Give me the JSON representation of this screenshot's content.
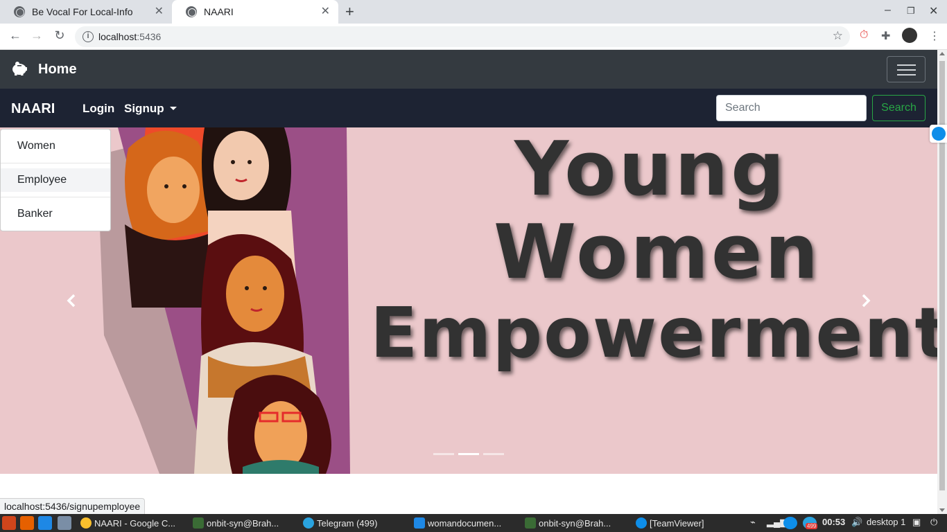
{
  "browser": {
    "tabs": [
      {
        "title": "Be Vocal For Local-Info",
        "active": false
      },
      {
        "title": "NAARI",
        "active": true
      }
    ],
    "url_host": "localhost",
    "url_port": ":5436",
    "status_url": "localhost:5436/signupemployee"
  },
  "topnav": {
    "home_label": "Home"
  },
  "subnav": {
    "brand": "NAARI",
    "login_label": "Login",
    "signup_label": "Signup",
    "search_placeholder": "Search",
    "search_button": "Search"
  },
  "signup_dropdown": {
    "items": [
      "Women",
      "Employee",
      "Banker"
    ],
    "hovered_item": "Employee"
  },
  "carousel": {
    "lines": [
      "Young",
      "Women",
      "Empowerment"
    ],
    "slide_count": 3,
    "active_slide": 2,
    "background_color": "#ebc8cb"
  },
  "taskbar": {
    "items": [
      "NAARI - Google C...",
      "onbit-syn@Brah...",
      "Telegram (499)",
      "womandocumen...",
      "onbit-syn@Brah...",
      "[TeamViewer]"
    ],
    "badge": "499",
    "clock": "00:53",
    "desktop": "desktop 1"
  },
  "colors": {
    "topnav_bg": "#343a40",
    "subnav_bg": "#1d2333",
    "search_green": "#28a745",
    "taskbar_bg": "#2b2b2b"
  }
}
